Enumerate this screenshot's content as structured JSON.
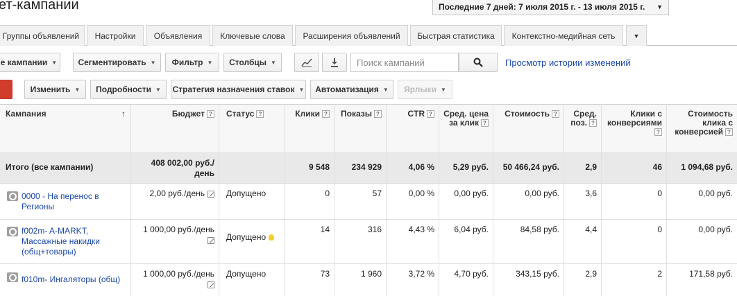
{
  "header": {
    "title": "ет-кампании",
    "date_range": "Последние 7 дней: 7 июля 2015 г. - 13 июля 2015 г."
  },
  "tabs": [
    {
      "label": "Группы объявлений"
    },
    {
      "label": "Настройки"
    },
    {
      "label": "Объявления"
    },
    {
      "label": "Ключевые слова"
    },
    {
      "label": "Расширения объявлений"
    },
    {
      "label": "Быстрая статистика"
    },
    {
      "label": "Контекстно-медийная сеть"
    }
  ],
  "toolbar1": {
    "all_campaigns": "е кампании",
    "segment": "Сегментировать",
    "filter": "Фильтр",
    "columns": "Столбцы",
    "search_placeholder": "Поиск кампаний",
    "history_link": "Просмотр истории изменений"
  },
  "toolbar2": {
    "change": "Изменить",
    "details": "Подробности",
    "bid_strategy": "Стратегия назначения ставок",
    "automation": "Автоматизация",
    "labels": "Ярлыки"
  },
  "table": {
    "headers": {
      "campaign": "Кампания",
      "sort_arrow": "↑",
      "budget": "Бюджет",
      "status": "Статус",
      "clicks": "Клики",
      "impressions": "Показы",
      "ctr": "CTR",
      "avg_cpc": "Сред. цена за клик",
      "cost": "Стоимость",
      "avg_pos": "Сред. поз.",
      "conv_clicks": "Клики с конверсиями",
      "cost_conv_click": "Стоимость клика с конверсией",
      "help": "?"
    },
    "total": {
      "label": "Итого (все кампании)",
      "budget": "408 002,00 руб./ день",
      "clicks": "9 548",
      "impressions": "234 929",
      "ctr": "4,06 %",
      "avg_cpc": "5,29 руб.",
      "cost": "50 466,24 руб.",
      "avg_pos": "2,9",
      "conv_clicks": "46",
      "cost_conv_click": "1 094,68 руб."
    },
    "rows": [
      {
        "name": "0000 - На перенос в Регионы",
        "budget": "2,00 руб./день",
        "status": "Допущено",
        "clicks": "0",
        "impressions": "57",
        "ctr": "0,00 %",
        "avg_cpc": "0,00 руб.",
        "cost": "0,00 руб.",
        "avg_pos": "3,6",
        "conv_clicks": "0",
        "cost_conv_click": "0,00 руб."
      },
      {
        "name": "f002m- A-MARKT, Массажные накидки (общ+товары)",
        "budget": "1 000,00 руб./день",
        "status": "Допущено",
        "clicks": "14",
        "impressions": "316",
        "ctr": "4,43 %",
        "avg_cpc": "6,04 руб.",
        "cost": "84,58 руб.",
        "avg_pos": "4,4",
        "conv_clicks": "0",
        "cost_conv_click": "0,00 руб."
      },
      {
        "name": "f010m- Ингаляторы (общ)",
        "budget": "1 000,00 руб./день",
        "status": "Допущено",
        "clicks": "73",
        "impressions": "1 960",
        "ctr": "3,72 %",
        "avg_cpc": "4,70 руб.",
        "cost": "343,15 руб.",
        "avg_pos": "2,9",
        "conv_clicks": "2",
        "cost_conv_click": "171,58 руб."
      }
    ]
  }
}
